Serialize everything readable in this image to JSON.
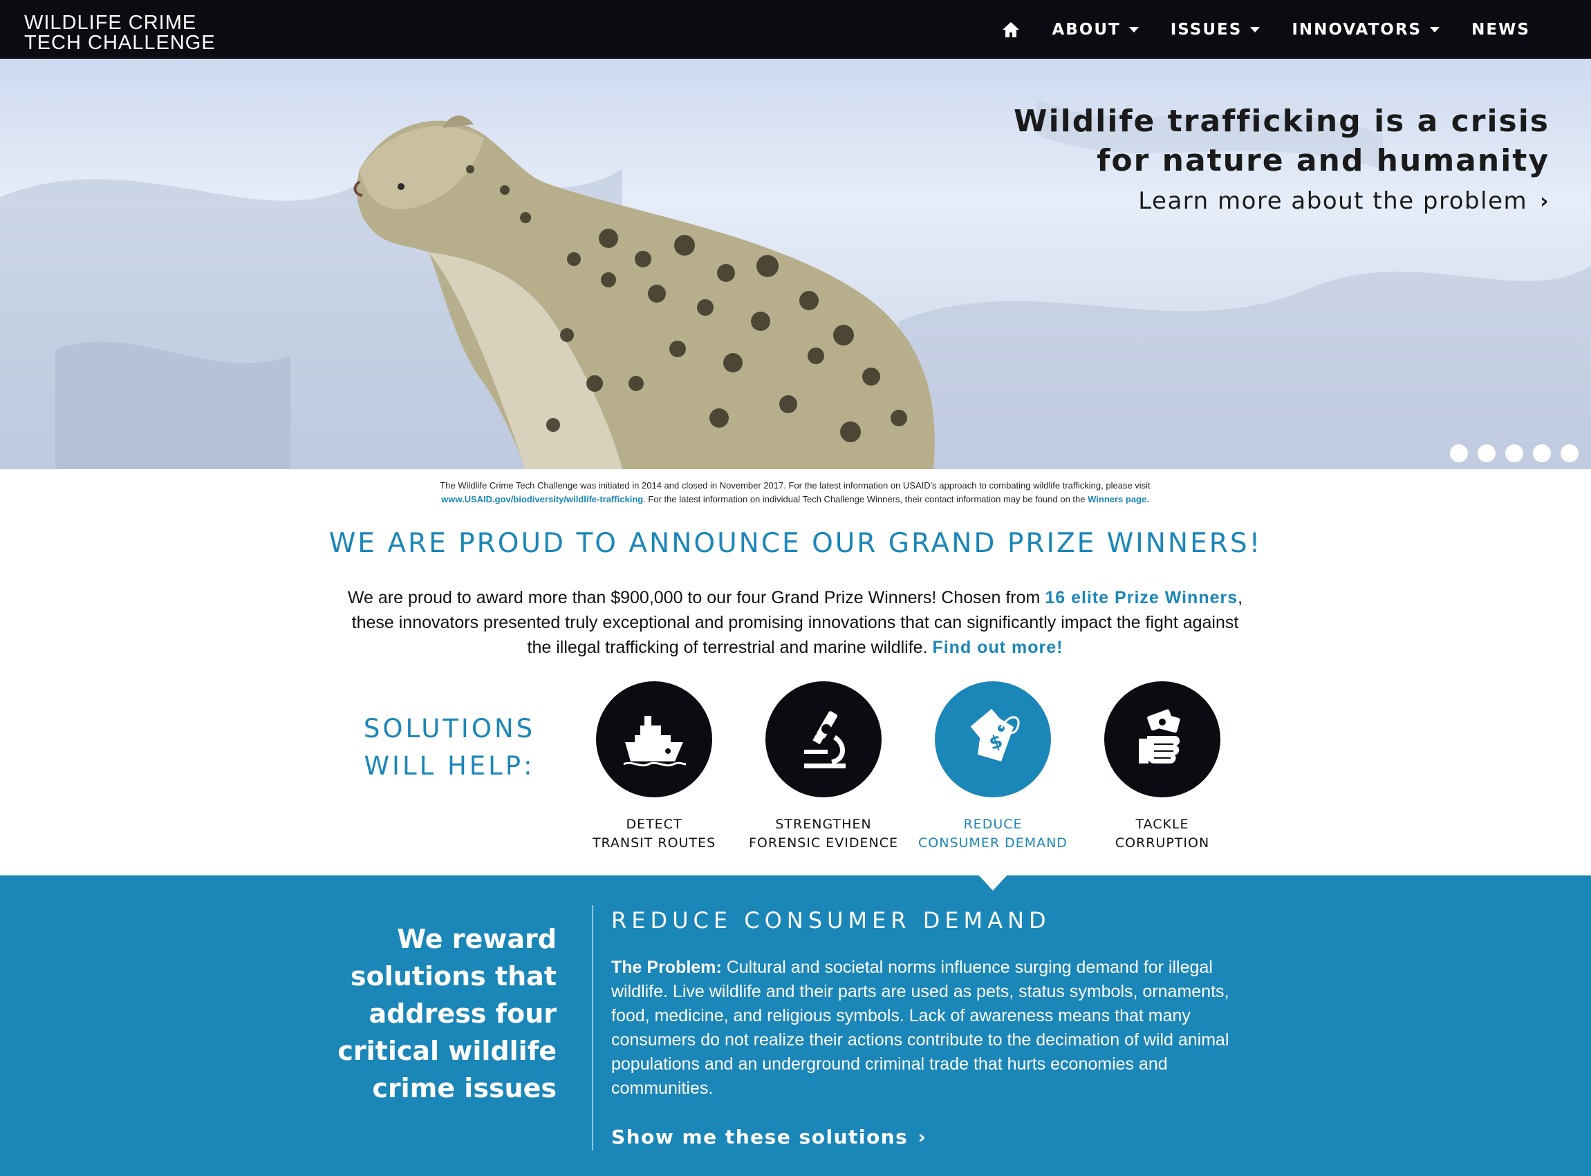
{
  "nav": {
    "brand_line1": "WILDLIFE CRIME",
    "brand_line2": "TECH CHALLENGE",
    "home_icon": "home-icon",
    "items": [
      {
        "label": "ABOUT",
        "dropdown": true
      },
      {
        "label": "ISSUES",
        "dropdown": true
      },
      {
        "label": "INNOVATORS",
        "dropdown": true
      },
      {
        "label": "NEWS",
        "dropdown": false
      }
    ]
  },
  "hero": {
    "headline_line1": "Wildlife trafficking is a crisis",
    "headline_line2": "for nature and humanity",
    "link": "Learn more about the problem",
    "slide_count": 5
  },
  "notice": {
    "text1": "The Wildlife Crime Tech Challenge was initiated in 2014 and closed in November 2017. For the latest information on USAID's approach to combating wildlife trafficking, please visit",
    "link1": "www.USAID.gov/biodiversity/wildlife-trafficking",
    "text2": ". For the latest information on individual Tech Challenge Winners, their contact information may be found on the",
    "link2": "Winners page."
  },
  "announce": {
    "title": "WE ARE PROUD TO ANNOUNCE OUR GRAND PRIZE WINNERS!",
    "text1": "We are proud to award more than $900,000 to our four Grand Prize Winners! Chosen from",
    "link1": "16 elite Prize Winners",
    "text2": ", these innovators presented truly exceptional and promising innovations that can significantly impact the fight against the illegal trafficking of terrestrial and marine wildlife.",
    "link2": "Find out more!"
  },
  "solutions": {
    "title_line1": "SOLUTIONS",
    "title_line2": "WILL HELP:",
    "items": [
      {
        "line1": "DETECT",
        "line2": "TRANSIT ROUTES",
        "icon": "ship-icon",
        "active": false
      },
      {
        "line1": "STRENGTHEN",
        "line2": "FORENSIC EVIDENCE",
        "icon": "microscope-icon",
        "active": false
      },
      {
        "line1": "REDUCE",
        "line2": "CONSUMER DEMAND",
        "icon": "price-tag-icon",
        "active": true
      },
      {
        "line1": "TACKLE",
        "line2": "CORRUPTION",
        "icon": "money-hand-icon",
        "active": false
      }
    ]
  },
  "panel": {
    "left_line1": "We reward",
    "left_line2": "solutions that",
    "left_line3": "address four",
    "left_line4": "critical wildlife",
    "left_line5": "crime issues",
    "heading": "REDUCE CONSUMER DEMAND",
    "problem_label": "The Problem:",
    "problem_text": " Cultural and societal norms influence surging demand for illegal wildlife. Live wildlife and their parts are used as pets, status symbols, ornaments, food, medicine, and religious symbols. Lack of awareness means that many consumers do not realize their actions contribute to the decimation of wild animal populations and an underground criminal trade that hurts economies and communities.",
    "link": "Show me these solutions"
  },
  "colors": {
    "nav_bg": "#0b0b12",
    "accent": "#1b86b8",
    "panel_bg": "#1b86b8"
  }
}
